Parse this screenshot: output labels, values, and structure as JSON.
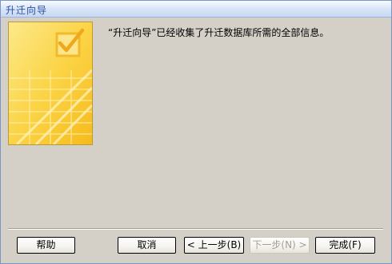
{
  "window": {
    "title": "升迁向导"
  },
  "wizard": {
    "message": "“升迁向导”已经收集了升迁数据库所需的全部信息。",
    "illustration_icon": "checklist-icon"
  },
  "buttons": {
    "help": "帮助",
    "cancel": "取消",
    "back": "< 上一步(B)",
    "next": "下一步(N) >",
    "finish": "完成(F)"
  },
  "state": {
    "next_enabled": false
  },
  "colors": {
    "dialog_bg": "#d4d0c8",
    "title_text": "#2b4ea3",
    "art_yellow": "#fbd23e"
  }
}
